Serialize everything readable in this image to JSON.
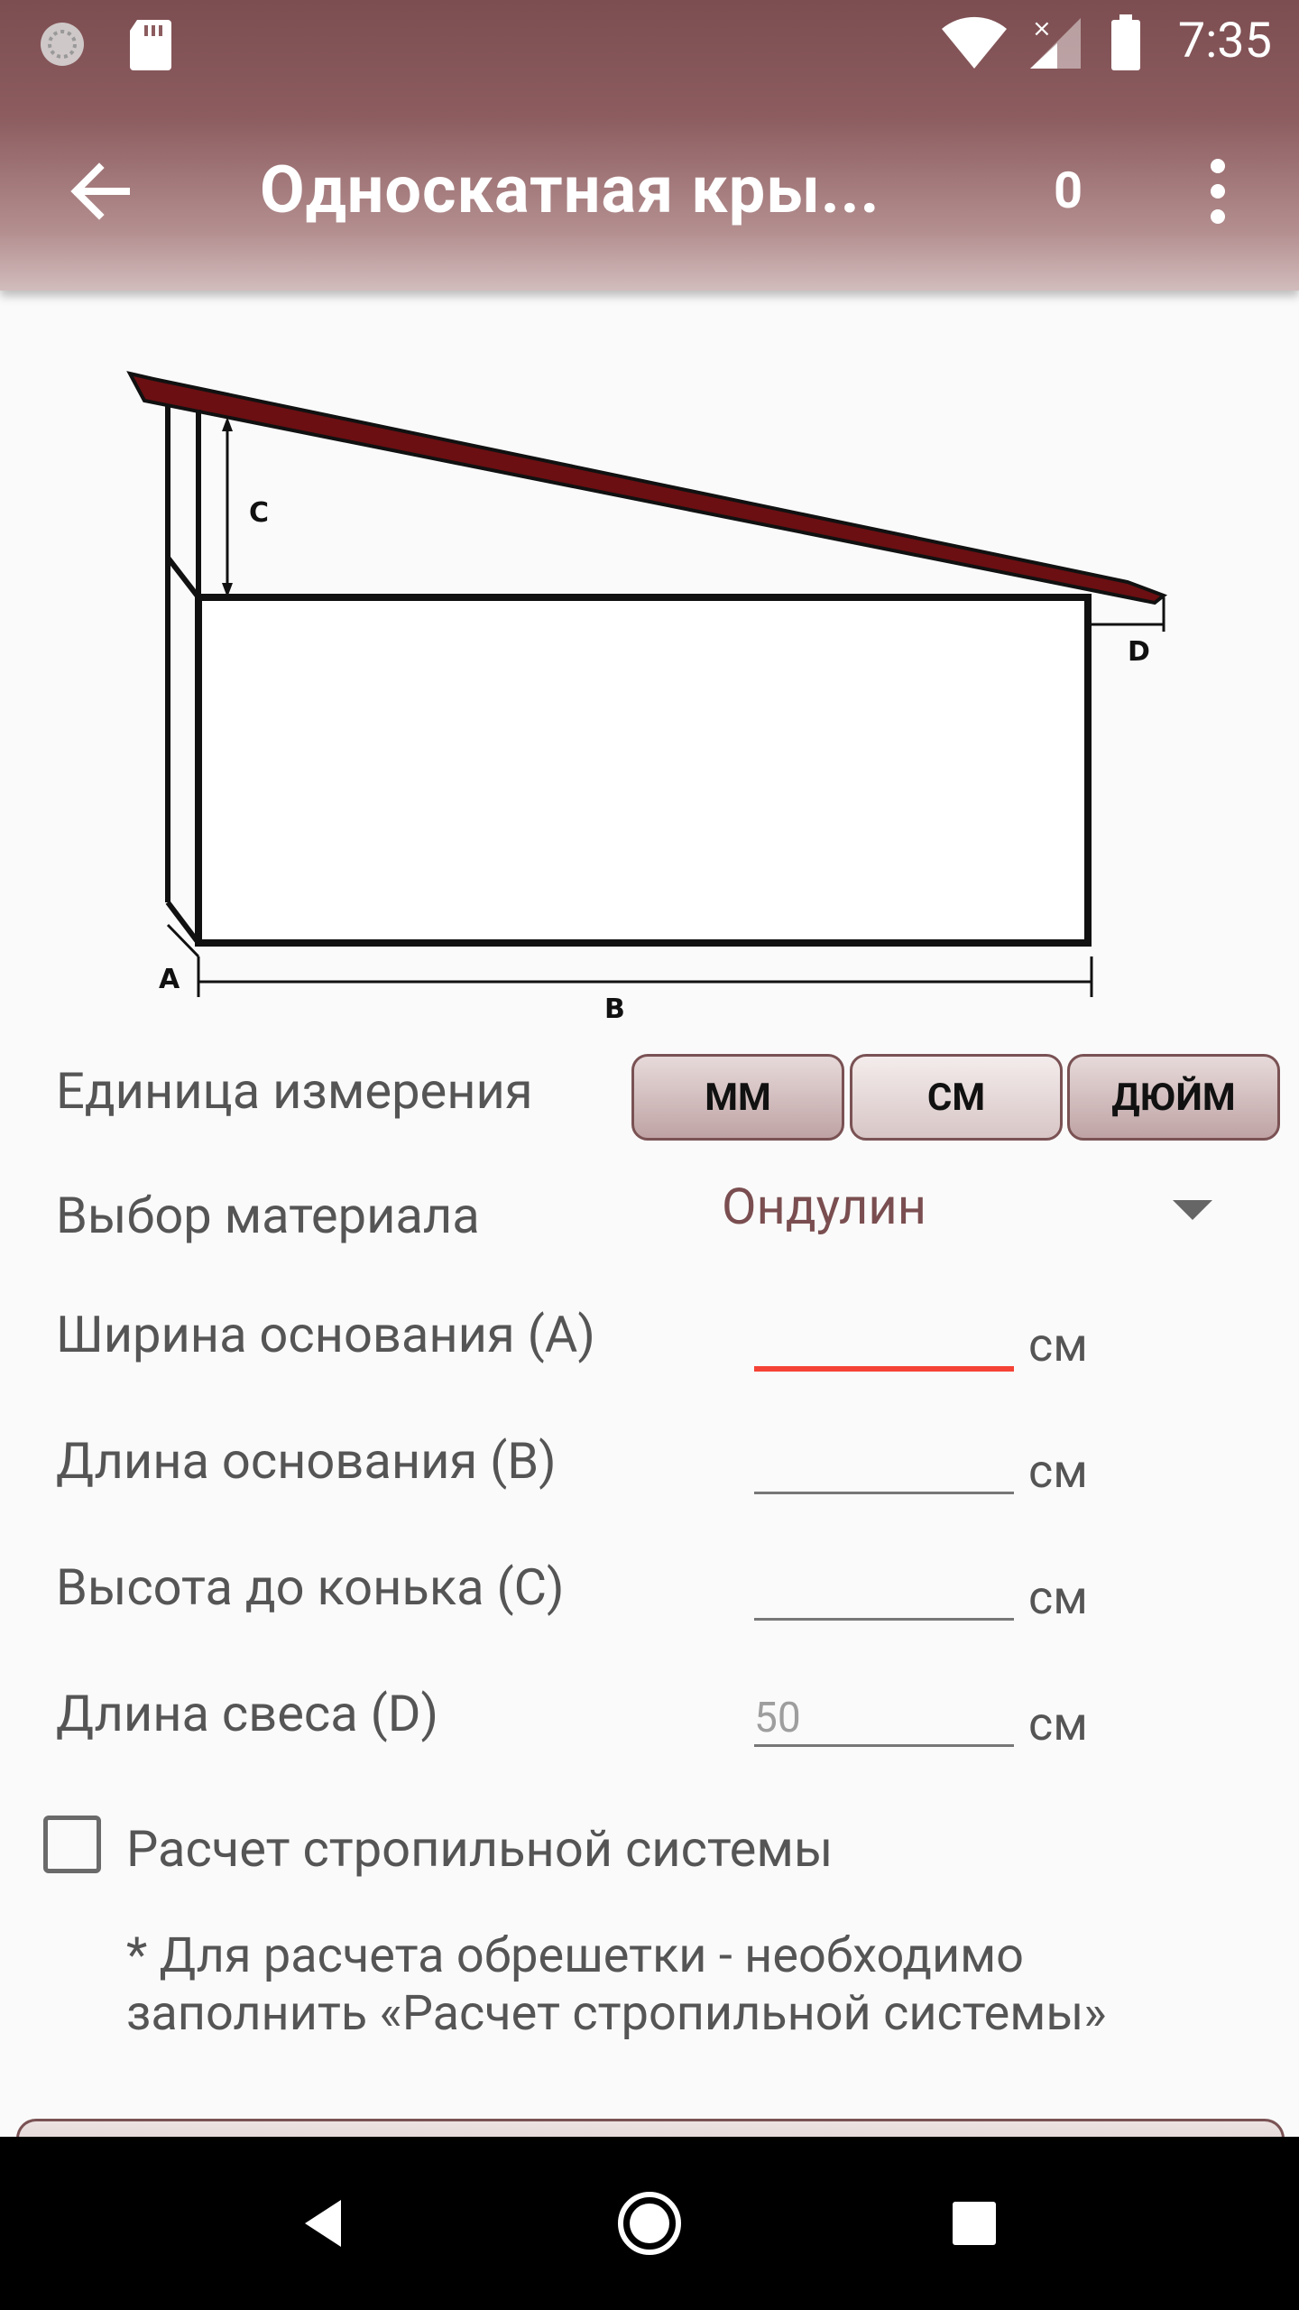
{
  "status_bar": {
    "time": "7:35",
    "icons": [
      "loading-icon",
      "sd-card-icon",
      "wifi-icon",
      "signal-icon",
      "battery-icon"
    ]
  },
  "app_bar": {
    "title": "Односкатная кры...",
    "counter": "0",
    "icons": [
      "back-arrow-icon",
      "more-vert-icon"
    ]
  },
  "diagram": {
    "labels": {
      "a": "A",
      "b": "B",
      "c": "C",
      "d": "D"
    },
    "roof_color": "#6b0f12"
  },
  "form": {
    "unit_label": "Единица измерения",
    "units": [
      {
        "label": "ММ",
        "selected": false
      },
      {
        "label": "СМ",
        "selected": true
      },
      {
        "label": "ДЮЙМ",
        "selected": false
      }
    ],
    "material_label": "Выбор материала",
    "material_value": "Ондулин",
    "fields": [
      {
        "label": "Ширина основания (A)",
        "value": "",
        "placeholder": "",
        "unit": "см",
        "error": true
      },
      {
        "label": "Длина основания (B)",
        "value": "",
        "placeholder": "",
        "unit": "см",
        "error": false
      },
      {
        "label": "Высота до конька (C)",
        "value": "",
        "placeholder": "",
        "unit": "см",
        "error": false
      },
      {
        "label": "Длина свеса (D)",
        "value": "",
        "placeholder": "50",
        "unit": "см",
        "error": false
      }
    ],
    "rafter_checkbox_label": "Расчет стропильной системы",
    "rafter_checked": false,
    "note": "* Для расчета обрешетки - необходимо заполнить «Расчет стропильной системы»"
  },
  "theme": {
    "accent": "#7a4e50",
    "error": "#f44336"
  }
}
